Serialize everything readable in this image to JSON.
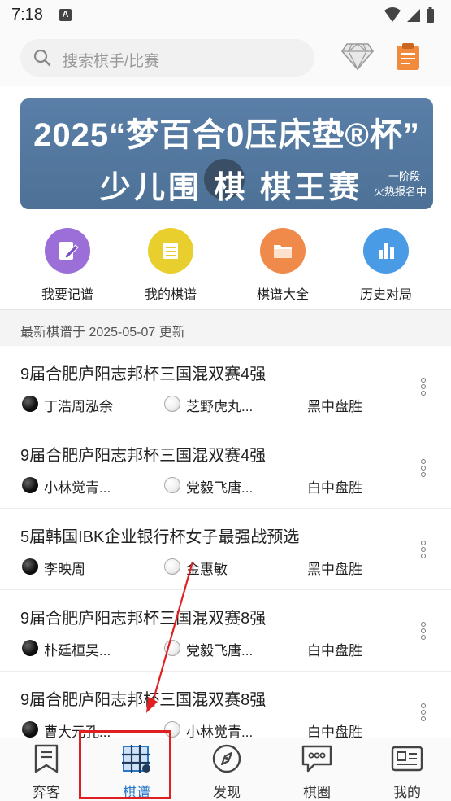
{
  "status": {
    "time": "7:18",
    "notif_glyph": "A"
  },
  "search": {
    "placeholder": "搜索棋手/比赛"
  },
  "icons": {
    "diamond": "diamond-icon",
    "clipboard": "clipboard-icon"
  },
  "banner": {
    "line1": "2025“梦百合0压床垫®杯”",
    "line2": "少儿围 棋 棋王赛",
    "side_line1": "一阶段",
    "side_line2": "火热报名中"
  },
  "quick_nav": [
    {
      "label": "我要记谱",
      "color": "#9c6fd8",
      "icon": "edit-icon"
    },
    {
      "label": "我的棋谱",
      "color": "#e8cf2e",
      "icon": "list-icon"
    },
    {
      "label": "棋谱大全",
      "color": "#ef8a4a",
      "icon": "folder-icon"
    },
    {
      "label": "历史对局",
      "color": "#4a9be6",
      "icon": "chart-icon"
    }
  ],
  "updated_text": "最新棋谱于 2025-05-07 更新",
  "games": [
    {
      "title": "9届合肥庐阳志邦杯三国混双赛4强",
      "black": "丁浩周泓余",
      "white": "芝野虎丸...",
      "result": "黑中盘胜"
    },
    {
      "title": "9届合肥庐阳志邦杯三国混双赛4强",
      "black": "小林觉青...",
      "white": "党毅飞唐...",
      "result": "白中盘胜"
    },
    {
      "title": "5届韩国IBK企业银行杯女子最强战预选",
      "black": "李映周",
      "white": "金惠敏",
      "result": "黑中盘胜"
    },
    {
      "title": "9届合肥庐阳志邦杯三国混双赛8强",
      "black": "朴廷桓吴...",
      "white": "党毅飞唐...",
      "result": "白中盘胜"
    },
    {
      "title": "9届合肥庐阳志邦杯三国混双赛8强",
      "black": "曹大元孔...",
      "white": "小林觉青...",
      "result": "白中盘胜"
    }
  ],
  "tabs": [
    {
      "label": "弈客",
      "icon": "bookmark-icon",
      "active": false
    },
    {
      "label": "棋谱",
      "icon": "board-icon",
      "active": true
    },
    {
      "label": "发现",
      "icon": "compass-icon",
      "active": false
    },
    {
      "label": "棋圈",
      "icon": "chat-icon",
      "active": false
    },
    {
      "label": "我的",
      "icon": "profile-card-icon",
      "active": false
    }
  ],
  "colors": {
    "accent": "#2878c8",
    "annotation": "#e02020",
    "banner": "#5a7fa8"
  }
}
